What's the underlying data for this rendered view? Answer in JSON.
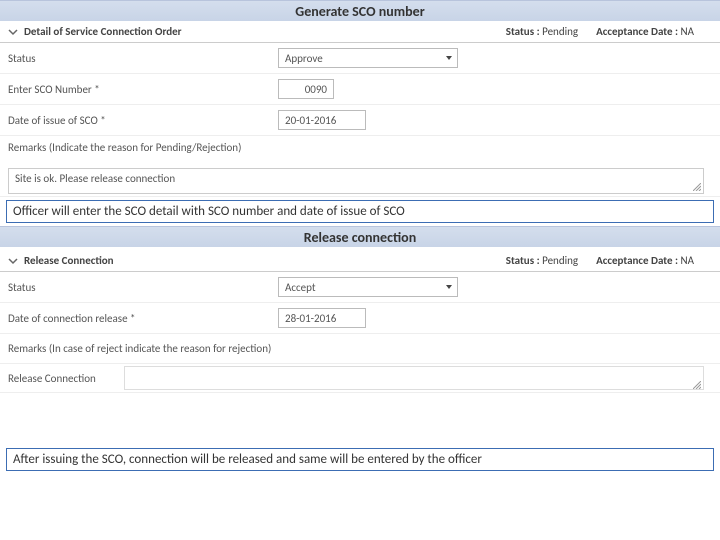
{
  "section1": {
    "heading": "Generate SCO number",
    "panel_title": "Detail of Service Connection Order",
    "status_label": "Status  :",
    "status_value": "Pending",
    "accept_label": "Acceptance Date :",
    "accept_value": "NA",
    "rows": {
      "status": {
        "label": "Status",
        "value": "Approve"
      },
      "sco_no": {
        "label": "Enter SCO Number",
        "value": "0090"
      },
      "sco_date": {
        "label": "Date of issue of SCO",
        "value": "20-01-2016"
      },
      "remarks_label": "Remarks (Indicate the reason for Pending/Rejection)",
      "remarks_value": "Site is ok. Please release connection"
    },
    "caption": "Officer will enter the SCO detail  with SCO number and date of issue of SCO"
  },
  "section2": {
    "heading": "Release connection",
    "panel_title": "Release Connection",
    "status_label": "Status  :",
    "status_value": "Pending",
    "accept_label": "Acceptance Date :",
    "accept_value": "NA",
    "rows": {
      "status": {
        "label": "Status",
        "value": "Accept"
      },
      "rel_date": {
        "label": "Date of connection release",
        "value": "28-01-2016"
      },
      "remarks_label": "Remarks (In case of reject indicate the reason for rejection)",
      "release_label": "Release Connection"
    },
    "caption": "After issuing the SCO, connection will be released and same will be entered by the officer"
  }
}
